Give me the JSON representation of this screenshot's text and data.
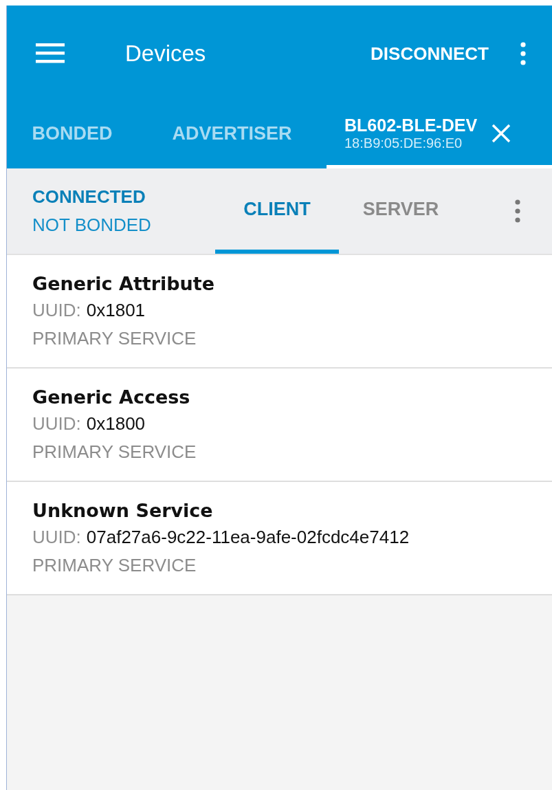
{
  "app_bar": {
    "title": "Devices",
    "action": "DISCONNECT"
  },
  "tabs": [
    {
      "label": "BONDED",
      "selected": false
    },
    {
      "label": "ADVERTISER",
      "selected": false
    },
    {
      "label": "BL602-BLE-DEV",
      "subtitle": "18:B9:05:DE:96:E0",
      "selected": true,
      "closable": true
    }
  ],
  "connection": {
    "status": "CONNECTED",
    "bond_state": "NOT BONDED"
  },
  "mode_tabs": [
    {
      "label": "CLIENT",
      "selected": true
    },
    {
      "label": "SERVER",
      "selected": false
    }
  ],
  "services": [
    {
      "name": "Generic Attribute",
      "uuid_label": "UUID:",
      "uuid": "0x1801",
      "type": "PRIMARY SERVICE"
    },
    {
      "name": "Generic Access",
      "uuid_label": "UUID:",
      "uuid": "0x1800",
      "type": "PRIMARY SERVICE"
    },
    {
      "name": "Unknown Service",
      "uuid_label": "UUID:",
      "uuid": "07af27a6-9c22-11ea-9afe-02fcdc4e7412",
      "type": "PRIMARY SERVICE"
    }
  ]
}
